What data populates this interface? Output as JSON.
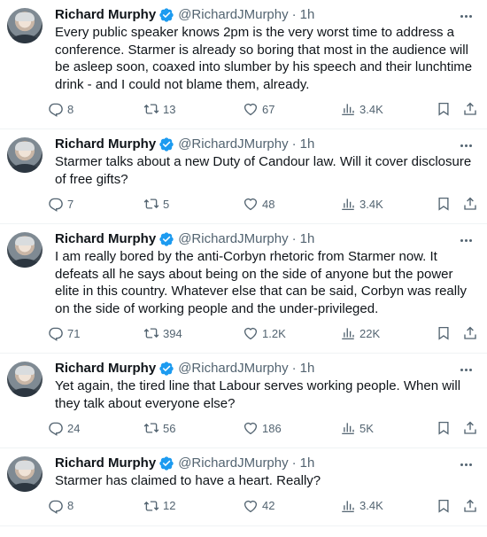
{
  "account": {
    "name": "Richard Murphy",
    "handle": "@RichardJMurphy",
    "dot": "·",
    "verified_color": "#1d9bf0"
  },
  "tweets": [
    {
      "time": "1h",
      "text": "Every public speaker knows 2pm is the very worst time to address a conference. Starmer is already so boring that most in the audience will be asleep soon, coaxed into slumber by his speech and their lunchtime drink - and I could not blame them, already.",
      "replies": "8",
      "retweets": "13",
      "likes": "67",
      "views": "3.4K"
    },
    {
      "time": "1h",
      "text": "Starmer talks about a new Duty of Candour law. Will it cover disclosure of free gifts?",
      "replies": "7",
      "retweets": "5",
      "likes": "48",
      "views": "3.4K"
    },
    {
      "time": "1h",
      "text": "I am really bored by the anti-Corbyn rhetoric from Starmer now. It defeats all he says about being on the side of anyone but the power elite in this country. Whatever else that can be said, Corbyn was really on the side of working people and the under-privileged.",
      "replies": "71",
      "retweets": "394",
      "likes": "1.2K",
      "views": "22K"
    },
    {
      "time": "1h",
      "text": "Yet again, the tired line that Labour serves working people. When will they talk about everyone else?",
      "replies": "24",
      "retweets": "56",
      "likes": "186",
      "views": "5K"
    },
    {
      "time": "1h",
      "text": "Starmer has claimed to have a heart. Really?",
      "replies": "8",
      "retweets": "12",
      "likes": "42",
      "views": "3.4K"
    }
  ]
}
